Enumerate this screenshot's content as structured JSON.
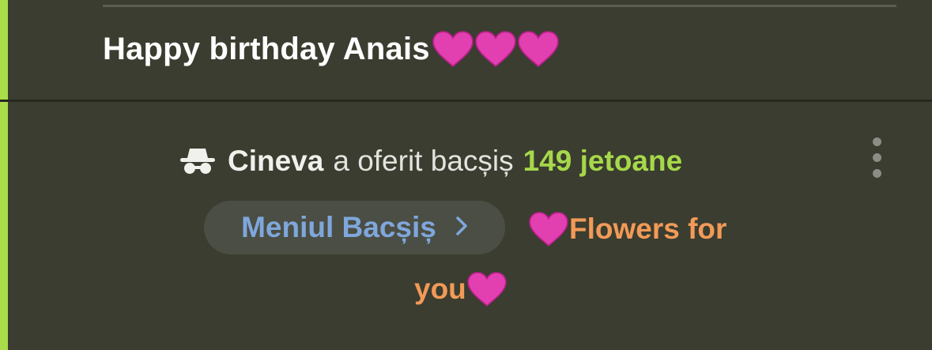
{
  "colors": {
    "background": "#3a3d2f",
    "accent_bar": "#a9dd4a",
    "message_text": "#ffffff",
    "tip_amount": "#a6d84a",
    "tip_menu_text": "#7fa7dc",
    "tip_item_text": "#f29a58",
    "heart": "#e23fb0"
  },
  "message": {
    "text": "Happy birthday Anais",
    "emoji_icons": [
      "heart-icon",
      "heart-icon",
      "heart-icon"
    ]
  },
  "tip_notification": {
    "icon": "anonymous-incognito-icon",
    "user": "Cineva",
    "verb": "a oferit bacșiș",
    "amount": "149 jetoane",
    "more_icon": "more-vertical-icon"
  },
  "tip_menu_button": {
    "label": "Meniul Bacșiș",
    "icon": "chevron-right-icon"
  },
  "tip_item": {
    "icon": "heart-icon",
    "line1": "Flowers for",
    "line2": "you"
  }
}
